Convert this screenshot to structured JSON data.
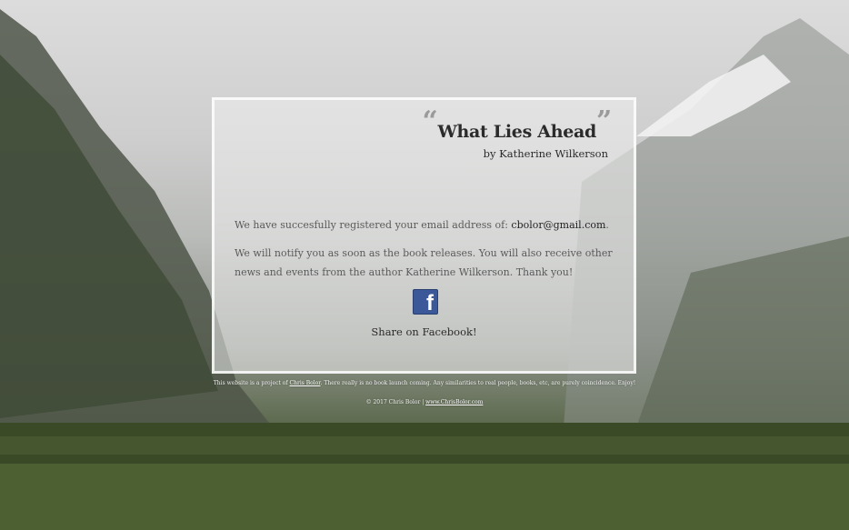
{
  "book": {
    "title": "What Lies Ahead",
    "open_quote": "“",
    "close_quote": "”",
    "byline": "by Katherine Wilkerson"
  },
  "message": {
    "line1_prefix": "We have succesfully registered your email address of: ",
    "email": "cbolor@gmail.com",
    "line1_suffix": ".",
    "line2": "We will notify you as soon as the book releases. You will also receive other news and events from the author Katherine Wilkerson. Thank you!"
  },
  "facebook": {
    "icon": "facebook-icon",
    "glyph": "f",
    "share_label": "Share on Facebook!",
    "color": "#3b5998"
  },
  "footer": {
    "line1_prefix": "This website is a project of ",
    "author_link": "Chris Bolor",
    "line1_suffix": ". There really is no book launch coming. Any similarities to real people, books, etc, are purely coincidence. Enjoy!",
    "copyright": "© 2017 Chris Bolor | ",
    "site_link": "www.ChrisBolor.com"
  }
}
